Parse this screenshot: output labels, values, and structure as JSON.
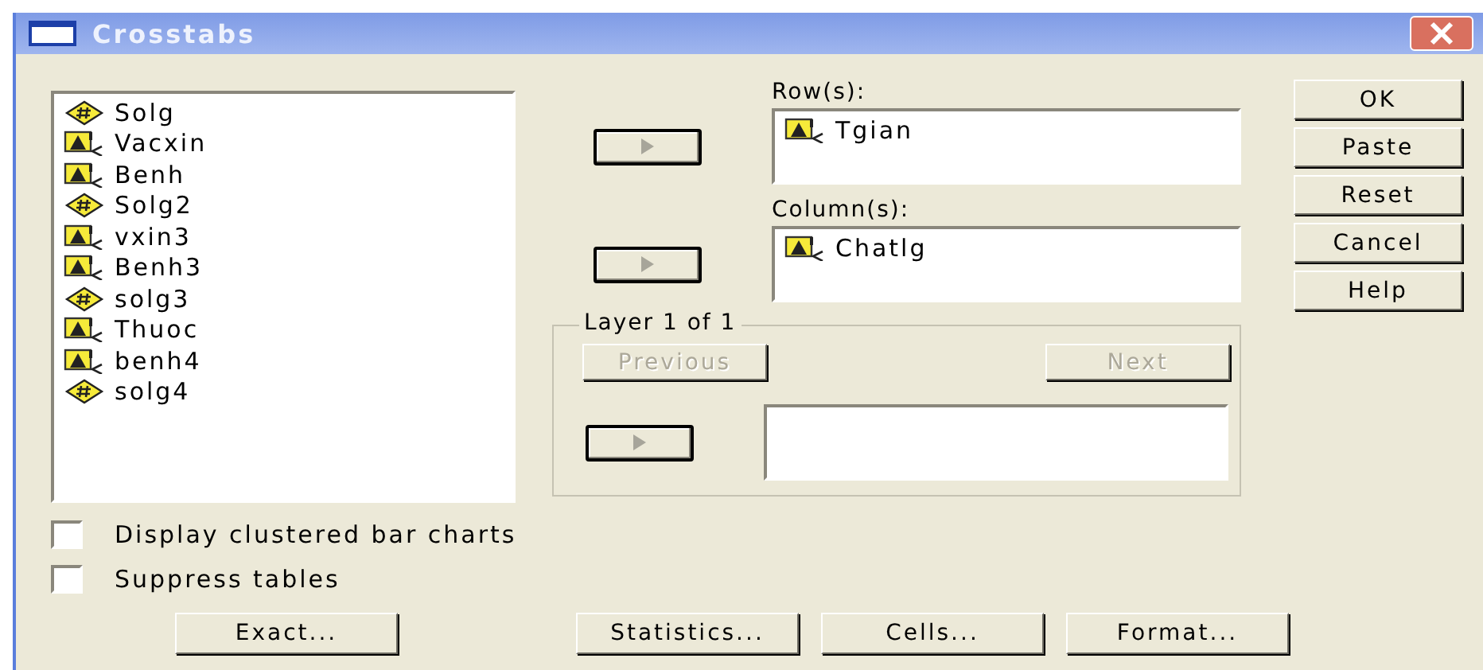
{
  "window": {
    "title": "Crosstabs"
  },
  "variables": [
    {
      "name": "Solg",
      "kind": "numeric"
    },
    {
      "name": "Vacxin",
      "kind": "string"
    },
    {
      "name": "Benh",
      "kind": "string"
    },
    {
      "name": "Solg2",
      "kind": "numeric"
    },
    {
      "name": "vxin3",
      "kind": "string"
    },
    {
      "name": "Benh3",
      "kind": "string"
    },
    {
      "name": "solg3",
      "kind": "numeric"
    },
    {
      "name": "Thuoc",
      "kind": "string"
    },
    {
      "name": "benh4",
      "kind": "string"
    },
    {
      "name": "solg4",
      "kind": "numeric"
    }
  ],
  "rows": {
    "label": "Row(s):",
    "variables": [
      {
        "name": "Tgian",
        "kind": "string"
      }
    ]
  },
  "columns": {
    "label": "Column(s):",
    "variables": [
      {
        "name": "Chatlg",
        "kind": "string"
      }
    ]
  },
  "layer": {
    "label": "Layer 1 of 1",
    "previous": {
      "label": "Previous",
      "disabled": true
    },
    "next": {
      "label": "Next",
      "disabled": true
    }
  },
  "action_buttons": [
    "OK",
    "Paste",
    "Reset",
    "Cancel",
    "Help"
  ],
  "options": [
    {
      "label": "Display clustered bar charts",
      "checked": false
    },
    {
      "label": "Suppress tables",
      "checked": false
    }
  ],
  "bottom_buttons": [
    "Exact...",
    "Statistics...",
    "Cells...",
    "Format..."
  ]
}
